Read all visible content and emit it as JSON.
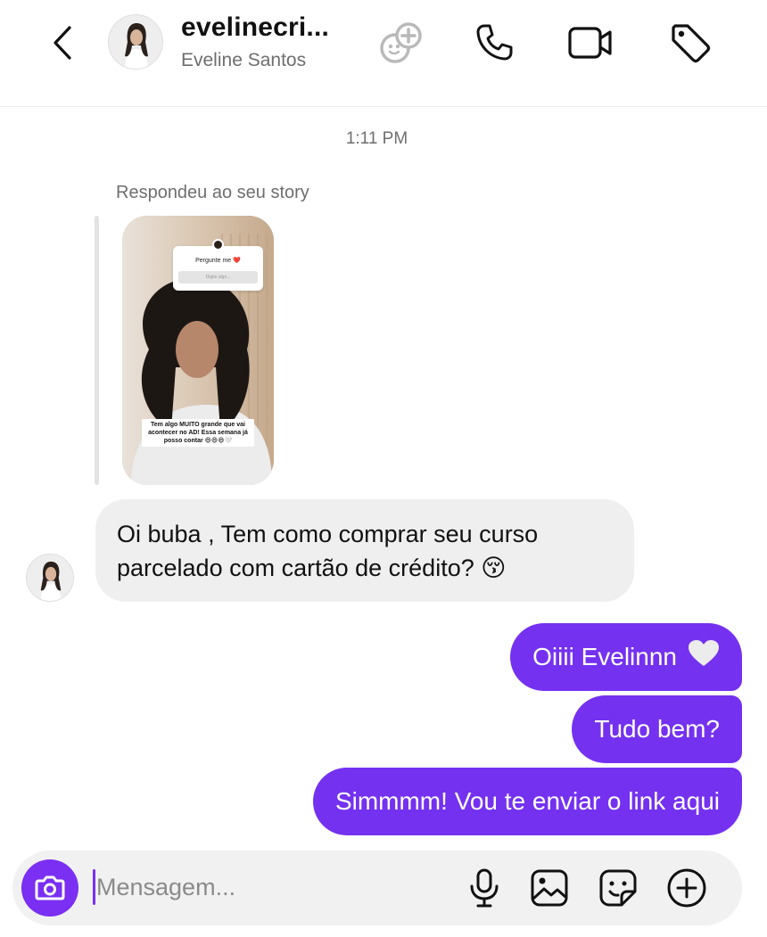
{
  "header": {
    "username": "evelinecri...",
    "full_name": "Eveline Santos",
    "icons": [
      "back-chevron-icon",
      "ai-sparkle-icon",
      "phone-icon",
      "video-camera-icon",
      "tag-icon"
    ]
  },
  "conversation": {
    "timestamp": "1:11 PM",
    "reply_label": "Respondeu ao seu story",
    "story": {
      "question_title": "Pergunte me ❤️",
      "question_placeholder": "Digite algo...",
      "caption": "Tem algo MUITO grande que vai acontecer no AD! Essa semana já posso contar 😄😄😄🤍"
    },
    "incoming_message": "Oi buba , Tem como comprar seu curso parcelado com cartão de crédito? 😚",
    "outgoing_messages": [
      {
        "text": "Oiiii Evelinnn",
        "emoji": "🤍"
      },
      {
        "text": "Tudo bem?"
      },
      {
        "text": "Simmmm! Vou te enviar o link aqui"
      }
    ]
  },
  "composer": {
    "placeholder": "Mensagem...",
    "icons": [
      "camera-icon",
      "microphone-icon",
      "gallery-icon",
      "sticker-icon",
      "plus-icon"
    ]
  },
  "colors": {
    "accent": "#7431f0",
    "incoming_bubble": "#efefef",
    "secondary_text": "#6e6e6e"
  }
}
